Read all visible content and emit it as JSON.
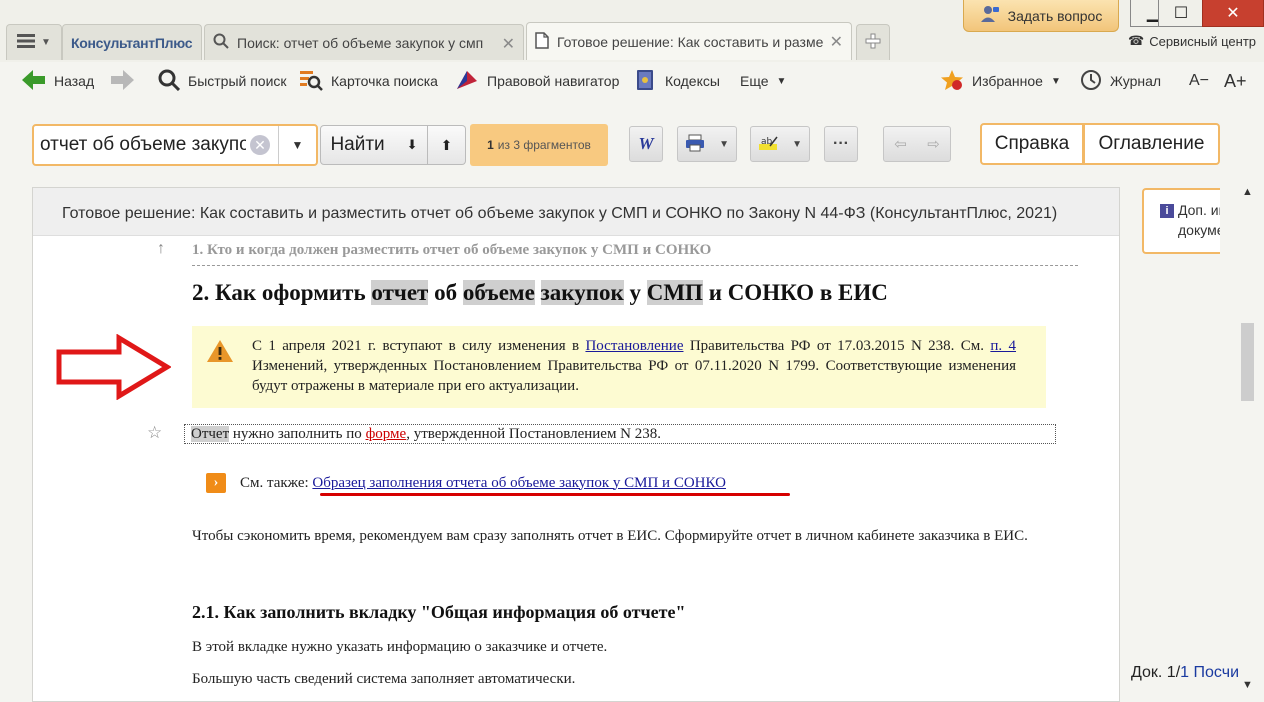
{
  "tabs": {
    "brand": "КонсультантПлюс",
    "search_tab": "Поиск: отчет об объеме закупок у смп",
    "doc_tab": "Готовое решение: Как составить и разме"
  },
  "window": {
    "ask_question": "Задать вопрос",
    "service_center": "Сервисный центр"
  },
  "toolbar": {
    "back": "Назад",
    "quick_search": "Быстрый поиск",
    "search_card": "Карточка поиска",
    "legal_navigator": "Правовой навигатор",
    "codes": "Кодексы",
    "more": "Еще",
    "favorites": "Избранное",
    "journal": "Журнал",
    "font_smaller": "A−",
    "font_larger": "A+"
  },
  "search": {
    "query": "отчет об объеме закупок у смп",
    "find_label": "Найти",
    "fragment_current": "1",
    "fragment_text": "из 3 фрагментов"
  },
  "right_buttons": {
    "help": "Справка",
    "contents": "Оглавление"
  },
  "document": {
    "header": "Готовое решение: Как составить и разместить отчет об объеме закупок у СМП и СОНКО по Закону N 44-ФЗ (КонсультантПлюс, 2021)",
    "prev_heading": "1. Кто и когда должен разместить отчет об объеме закупок у СМП и СОНКО",
    "heading": {
      "num": "2. Как оформить",
      "w1": "отчет",
      "t1": "об",
      "w2": "объеме",
      "w3": "закупок",
      "t2": "у",
      "w4": "СМП",
      "t3": "и СОНКО в ЕИС"
    },
    "warning": {
      "p1": "С 1 апреля 2021 г. вступают в силу изменения в",
      "link1": "Постановление",
      "p2": "Правительства РФ от 17.03.2015 N 238. См.",
      "link2": "п. 4",
      "p3": "Изменений, утвержденных Постановлением Правительства РФ от 07.11.2020 N 1799. Соответствующие изменения будут отражены в материале при его актуализации."
    },
    "form_line": {
      "w1": "Отчет",
      "t1": "нужно заполнить по",
      "link": "форме",
      "t2": ", утвержденной Постановлением N 238."
    },
    "see_also_label": "См. также:",
    "see_also_link": "Образец заполнения отчета об объеме закупок у СМП и СОНКО",
    "para1": "Чтобы сэкономить время, рекомендуем вам сразу заполнять отчет в ЕИС. Сформируйте отчет в личном кабинете заказчика в ЕИС.",
    "subheading": "2.1. Как заполнить вкладку \"Общая информация об отчете\"",
    "para2": "В этой вкладке нужно указать информацию о заказчике и отчете.",
    "para3": "Большую часть сведений система заполняет автоматически."
  },
  "sidebar": {
    "info_line1": "Доп. информация",
    "info_line2": "документа"
  },
  "status": {
    "doc_label": "Док. 1/",
    "doc_total": "1",
    "doc_tail": "Посчитать"
  },
  "colors": {
    "accent_orange": "#f2b866",
    "link_blue": "#1a1a9a",
    "annotation_red": "#d60000"
  }
}
